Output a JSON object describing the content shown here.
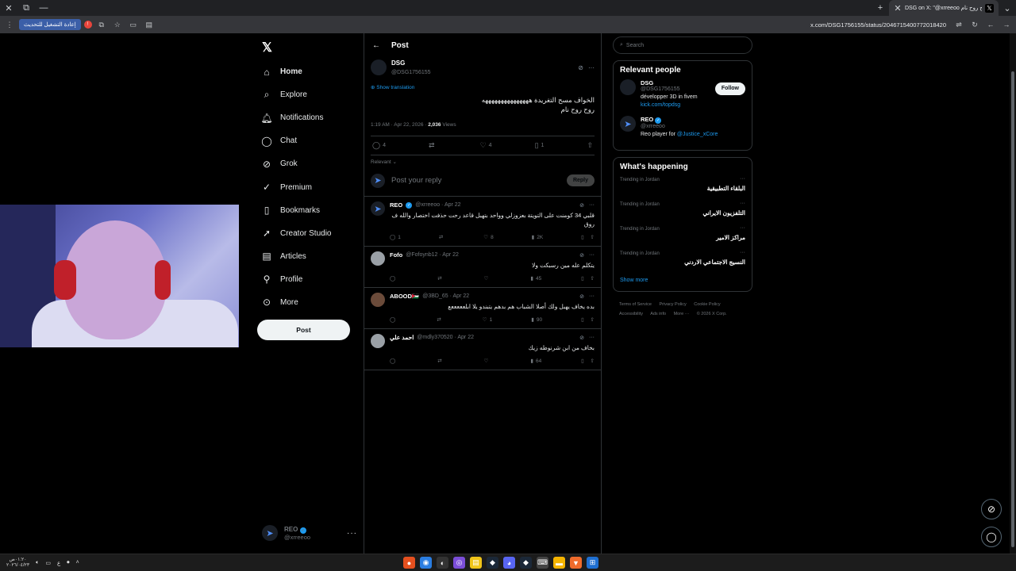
{
  "browser": {
    "tab_title": "DSG on X: \"@xrreeoo روح روح نام",
    "url": "x.com/DSG1756155/status/2046715400772018420",
    "reload_label": "إعادة التشغيل للتحديث",
    "update_badge": "!"
  },
  "nav": {
    "items": [
      {
        "label": "Home",
        "icon": "home-icon"
      },
      {
        "label": "Explore",
        "icon": "search-icon"
      },
      {
        "label": "Notifications",
        "icon": "bell-icon"
      },
      {
        "label": "Chat",
        "icon": "chat-icon"
      },
      {
        "label": "Grok",
        "icon": "grok-icon"
      },
      {
        "label": "Premium",
        "icon": "premium-icon"
      },
      {
        "label": "Bookmarks",
        "icon": "bookmark-icon"
      },
      {
        "label": "Creator Studio",
        "icon": "rocket-icon"
      },
      {
        "label": "Articles",
        "icon": "article-icon"
      },
      {
        "label": "Profile",
        "icon": "person-icon"
      },
      {
        "label": "More",
        "icon": "more-circle-icon"
      }
    ],
    "post_button": "Post",
    "account": {
      "name": "REO",
      "handle": "@xrreeoo"
    }
  },
  "main": {
    "header_title": "Post",
    "post": {
      "author": "DSG",
      "handle": "@DSG1756155",
      "show_translation": "Show translation",
      "text_line1": "الخواف مسح التغريدة هههههههههههههههه",
      "text_line2": "روح روح نام",
      "time": "1:19 AM · Apr 22, 2026 · ",
      "views_count": "2,036",
      "views_label": " Views",
      "replies": "4",
      "reposts": "",
      "likes": "4",
      "bookmarks": "1"
    },
    "sort_label": "Relevant",
    "reply_placeholder": "Post your reply",
    "reply_button": "Reply",
    "replies": [
      {
        "name": "REO",
        "verified": true,
        "handle": "@xrreeoo · Apr 22",
        "text": "قلبي 34 كومنت على التويتة بعزوزلي وواحد بتهبل قاعد رحت حذفت اختصار والله ف روق",
        "replies": "1",
        "reposts": "",
        "likes": "8",
        "views": "2K",
        "avatar": "blue"
      },
      {
        "name": "Fofo",
        "verified": false,
        "handle": "@Fofoynb12 · Apr 22",
        "text": "يتكلم عله مين رسبكت ولا",
        "replies": "",
        "reposts": "",
        "likes": "",
        "views": "45",
        "avatar": "gray"
      },
      {
        "name": "ABOOD🇯🇴",
        "verified": false,
        "handle": "@3BD_65 · Apr 22",
        "text": "بده يخاف يهبل ولك أصلا الشباب هم بدهم يتبندو يلا ابلعععععع",
        "replies": "",
        "reposts": "",
        "likes": "1",
        "views": "90",
        "avatar": "pic"
      },
      {
        "name": "احمد علي",
        "verified": false,
        "handle": "@mdly370520 · Apr 22",
        "text": "بخاف من ابن شرنوطه زيك",
        "replies": "",
        "reposts": "",
        "likes": "",
        "views": "64",
        "avatar": "gray"
      }
    ]
  },
  "right": {
    "search_placeholder": "Search",
    "relevant_title": "Relevant people",
    "people": [
      {
        "name": "DSG",
        "handle": "@DSG1756155",
        "bio": "développer 3D in fivem",
        "link": "kick.com/topdsg",
        "follow": "Follow"
      },
      {
        "name": "REO",
        "handle": "@xrreeoo",
        "bio": "Reo player for ",
        "link": "@Justice_xCore"
      }
    ],
    "happening_title": "What's happening",
    "trends": [
      {
        "sub": "Trending in Jordan",
        "title": "البلقاء التطبيقية"
      },
      {
        "sub": "Trending in Jordan",
        "title": "التلفزيون الايراني"
      },
      {
        "sub": "Trending in Jordan",
        "title": "مراكز الامير"
      },
      {
        "sub": "Trending in Jordan",
        "title": "النسيج الاجتماعي الاردني"
      }
    ],
    "show_more": "Show more",
    "footer": [
      "Terms of Service",
      "Privacy Policy",
      "Cookie Policy",
      "Accessibility",
      "Ads info",
      "More ···",
      "© 2026 X Corp."
    ]
  },
  "taskbar": {
    "clock_time": "٠١:٢٠ص",
    "clock_date": "٢٠٢٦/٠٤/٢٣",
    "lang": "ع"
  },
  "colors": {
    "accent": "#1d9bf0",
    "bg": "#000000",
    "border": "#2f3336",
    "muted": "#71767b"
  }
}
